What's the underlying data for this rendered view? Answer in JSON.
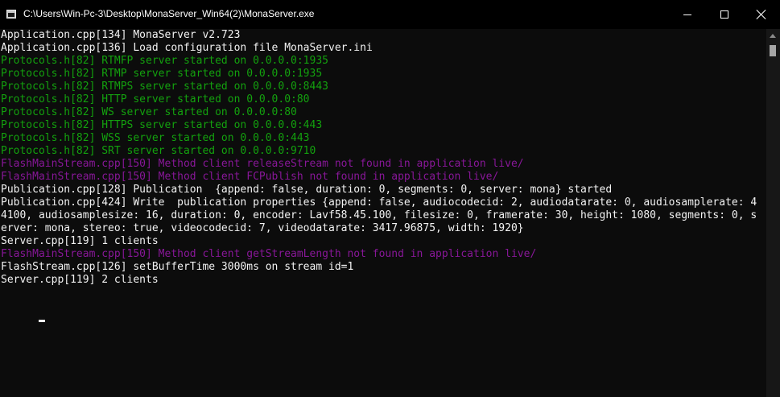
{
  "window": {
    "title": "C:\\Users\\Win-Pc-3\\Desktop\\MonaServer_Win64(2)\\MonaServer.exe",
    "icon": "console-app-icon",
    "controls": {
      "minimize_icon": "minimize-icon",
      "maximize_icon": "maximize-icon",
      "close_icon": "close-icon"
    }
  },
  "colors": {
    "background": "#0c0c0c",
    "default_text": "#cccccc",
    "info_text": "#f2f2f2",
    "green_text": "#13a10e",
    "magenta_text": "#881798"
  },
  "console": {
    "lines": [
      {
        "text": "Application.cpp[134] MonaServer v2.723",
        "color": "#f2f2f2"
      },
      {
        "text": "Application.cpp[136] Load configuration file MonaServer.ini",
        "color": "#f2f2f2"
      },
      {
        "text": "Protocols.h[82] RTMFP server started on 0.0.0.0:1935",
        "color": "#13a10e"
      },
      {
        "text": "Protocols.h[82] RTMP server started on 0.0.0.0:1935",
        "color": "#13a10e"
      },
      {
        "text": "Protocols.h[82] RTMPS server started on 0.0.0.0:8443",
        "color": "#13a10e"
      },
      {
        "text": "Protocols.h[82] HTTP server started on 0.0.0.0:80",
        "color": "#13a10e"
      },
      {
        "text": "Protocols.h[82] WS server started on 0.0.0.0:80",
        "color": "#13a10e"
      },
      {
        "text": "Protocols.h[82] HTTPS server started on 0.0.0.0:443",
        "color": "#13a10e"
      },
      {
        "text": "Protocols.h[82] WSS server started on 0.0.0.0:443",
        "color": "#13a10e"
      },
      {
        "text": "Protocols.h[82] SRT server started on 0.0.0.0:9710",
        "color": "#13a10e"
      },
      {
        "text": "FlashMainStream.cpp[150] Method client releaseStream not found in application live/",
        "color": "#881798"
      },
      {
        "text": "FlashMainStream.cpp[150] Method client FCPublish not found in application live/",
        "color": "#881798"
      },
      {
        "text": "Publication.cpp[128] Publication  {append: false, duration: 0, segments: 0, server: mona} started",
        "color": "#f2f2f2"
      },
      {
        "text": "Publication.cpp[424] Write  publication properties {append: false, audiocodecid: 2, audiodatarate: 0, audiosamplerate: 4",
        "color": "#f2f2f2"
      },
      {
        "text": "4100, audiosamplesize: 16, duration: 0, encoder: Lavf58.45.100, filesize: 0, framerate: 30, height: 1080, segments: 0, s",
        "color": "#f2f2f2"
      },
      {
        "text": "erver: mona, stereo: true, videocodecid: 7, videodatarate: 3417.96875, width: 1920}",
        "color": "#f2f2f2"
      },
      {
        "text": "Server.cpp[119] 1 clients",
        "color": "#f2f2f2"
      },
      {
        "text": "FlashMainStream.cpp[150] Method client getStreamLength not found in application live/",
        "color": "#881798"
      },
      {
        "text": "FlashStream.cpp[126] setBufferTime 3000ms on stream id=1",
        "color": "#f2f2f2"
      },
      {
        "text": "Server.cpp[119] 2 clients",
        "color": "#f2f2f2"
      }
    ]
  }
}
